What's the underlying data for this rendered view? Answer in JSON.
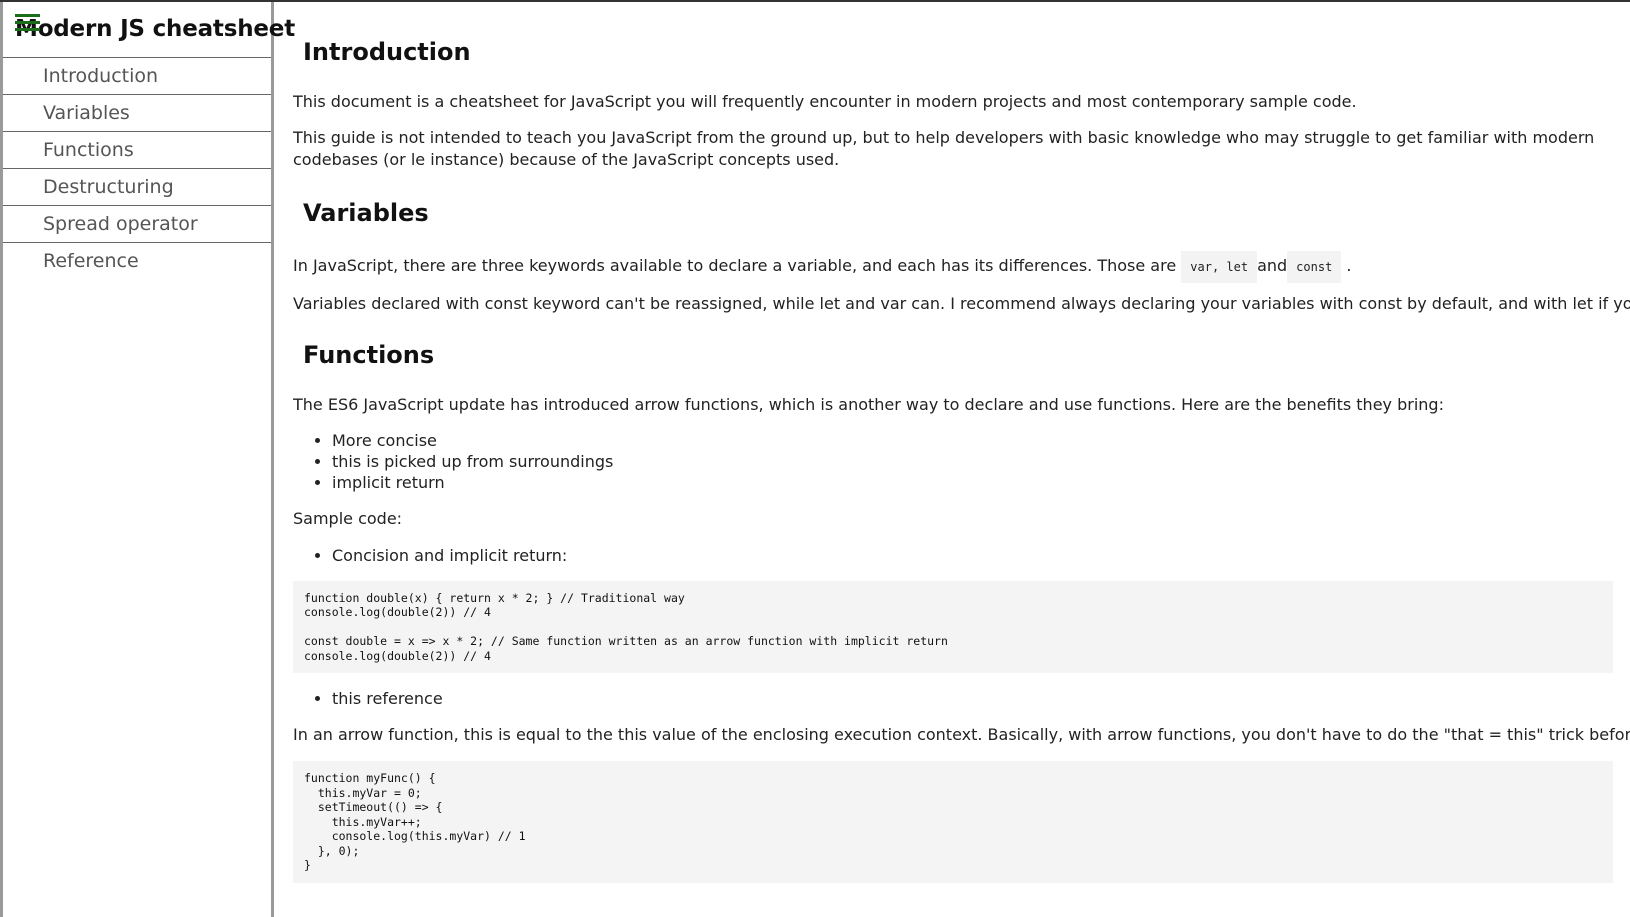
{
  "sidebar": {
    "title": "Modern JS cheatsheet",
    "menu_icon": "hamburger-menu-icon",
    "items": [
      {
        "label": "Introduction"
      },
      {
        "label": "Variables"
      },
      {
        "label": "Functions"
      },
      {
        "label": "Destructuring"
      },
      {
        "label": "Spread operator"
      },
      {
        "label": "Reference"
      }
    ]
  },
  "content": {
    "introduction": {
      "heading": "Introduction",
      "p1": "This document is a cheatsheet for JavaScript you will frequently encounter in modern projects and most contemporary sample code.",
      "p2": "This guide is not intended to teach you JavaScript from the ground up, but to help developers with basic knowledge who may struggle to get familiar with modern codebases (or le instance) because of the JavaScript concepts used."
    },
    "variables": {
      "heading": "Variables",
      "p1_before": "In JavaScript, there are three keywords available to declare a variable, and each has its differences. Those are",
      "code1": "var, let",
      "p1_mid": "and",
      "code2": "const",
      "p1_after": ".",
      "p2": "Variables declared with const keyword can't be reassigned, while let and var can. I recommend always declaring your variables with const by default, and with let if you need to mu"
    },
    "functions": {
      "heading": "Functions",
      "p1": "The ES6 JavaScript update has introduced arrow functions, which is another way to declare and use functions. Here are the benefits they bring:",
      "benefits": [
        "More concise",
        "this is picked up from surroundings",
        "implicit return"
      ],
      "sample_label": "Sample code:",
      "bullet_concision": "Concision and implicit return:",
      "code_sample_1": "function double(x) { return x * 2; } // Traditional way\nconsole.log(double(2)) // 4\n\nconst double = x => x * 2; // Same function written as an arrow function with implicit return\nconsole.log(double(2)) // 4",
      "bullet_this": "this reference",
      "p_this": "In an arrow function, this is equal to the this value of the enclosing execution context. Basically, with arrow functions, you don't have to do the \"that = this\" trick before calling a fur",
      "code_sample_2": "function myFunc() {\n  this.myVar = 0;\n  setTimeout(() => {\n    this.myVar++;\n    console.log(this.myVar) // 1\n  }, 0);\n}"
    }
  },
  "colors": {
    "menu_icon": "#1a6e1a",
    "code_background": "#f4f4f4",
    "sidebar_border": "#9a9a9a"
  }
}
